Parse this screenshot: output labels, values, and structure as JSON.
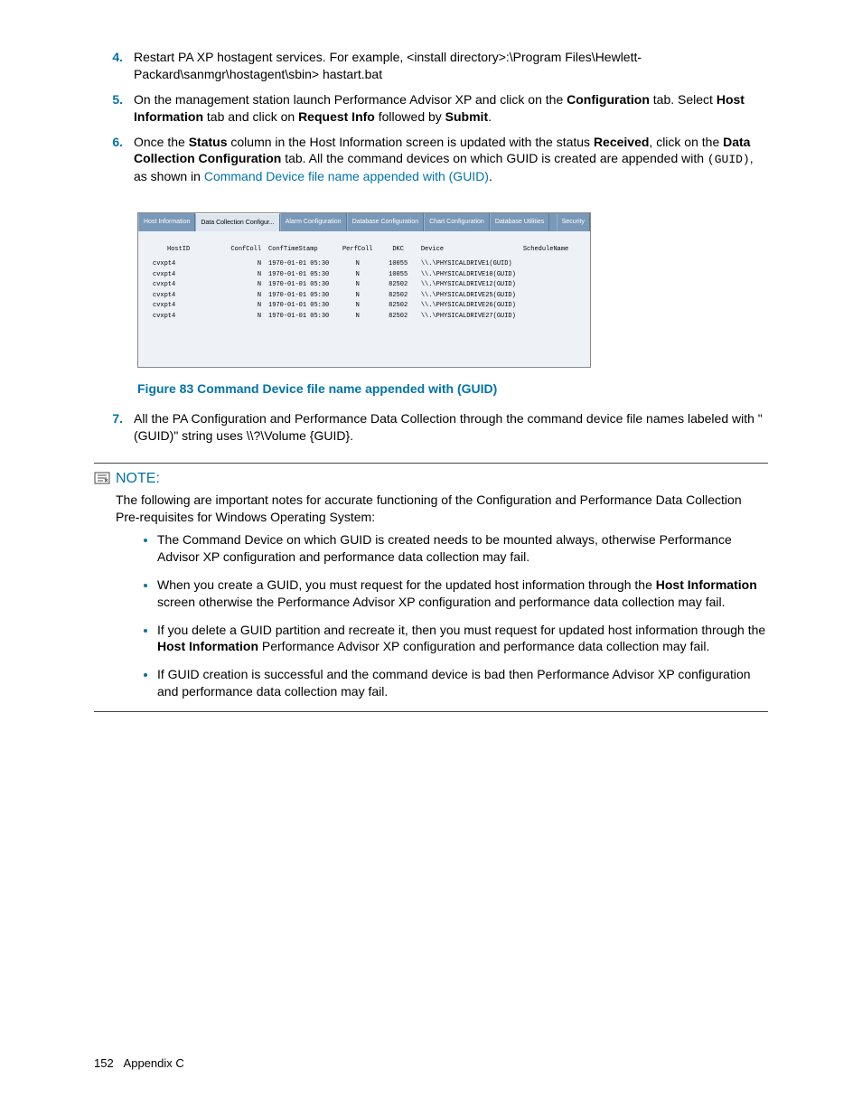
{
  "items": {
    "i4": {
      "num": "4.",
      "a": "Restart PA XP hostagent services.  For example, <install directory>:\\Program Files\\Hewlett-Packard\\sanmgr\\hostagent\\sbin> hastart.bat"
    },
    "i5": {
      "num": "5.",
      "a": "On the management station launch Performance Advisor XP and click on the ",
      "b": "Configuration",
      "c": " tab. Select ",
      "d": "Host Information",
      "e": " tab and click on ",
      "f": "Request Info",
      "g": " followed by ",
      "h": "Submit",
      "i": "."
    },
    "i6": {
      "num": "6.",
      "a": "Once the ",
      "b": "Status",
      "c": " column in the Host Information screen is updated with the status ",
      "d": "Received",
      "e": ", click on the ",
      "f": "Data Collection Configuration",
      "g": " tab.  All the command devices on which GUID is created are appended with ",
      "h": "(GUID)",
      "i": ", as shown in ",
      "j": "Command Device file name appended with (GUID)",
      "k": "."
    },
    "i7": {
      "num": "7.",
      "a": "All the PA Configuration and Performance Data Collection through the command device file names labeled with \"(GUID)\" string uses \\\\?\\Volume {GUID}."
    }
  },
  "figure": {
    "caption": "Figure 83 Command Device file name appended with (GUID)",
    "tabs": [
      "Host Information",
      "Data Collection Configur...",
      "Alarm Configuration",
      "Database Configuration",
      "Chart Configuration",
      "Database Utilities",
      "Security"
    ],
    "headers": {
      "h1": "HostID",
      "h2": "ConfColl",
      "h3": "ConfTimeStamp",
      "h4": "PerfColl",
      "h5": "DKC",
      "h6": "Device",
      "h7": "ScheduleName"
    },
    "rows": [
      {
        "host": "cvxpt4",
        "conf": "N",
        "ts": "1970-01-01 05:30",
        "perf": "N",
        "dkc": "10055",
        "dev": "\\\\.\\PHYSICALDRIVE1(GUID)"
      },
      {
        "host": "cvxpt4",
        "conf": "N",
        "ts": "1970-01-01 05:30",
        "perf": "N",
        "dkc": "10055",
        "dev": "\\\\.\\PHYSICALDRIVE10(GUID)"
      },
      {
        "host": "cvxpt4",
        "conf": "N",
        "ts": "1970-01-01 05:30",
        "perf": "N",
        "dkc": "82502",
        "dev": "\\\\.\\PHYSICALDRIVE12(GUID)"
      },
      {
        "host": "cvxpt4",
        "conf": "N",
        "ts": "1970-01-01 05:30",
        "perf": "N",
        "dkc": "82502",
        "dev": "\\\\.\\PHYSICALDRIVE25(GUID)"
      },
      {
        "host": "cvxpt4",
        "conf": "N",
        "ts": "1970-01-01 05:30",
        "perf": "N",
        "dkc": "82502",
        "dev": "\\\\.\\PHYSICALDRIVE26(GUID)"
      },
      {
        "host": "cvxpt4",
        "conf": "N",
        "ts": "1970-01-01 05:30",
        "perf": "N",
        "dkc": "82502",
        "dev": "\\\\.\\PHYSICALDRIVE27(GUID)"
      }
    ]
  },
  "note": {
    "label": "NOTE:",
    "intro": "The following are important notes for accurate functioning of the Configuration and Performance Data Collection Pre-requisites for Windows Operating System:",
    "b1": "The Command Device on which GUID is created needs to be mounted always, otherwise Performance Advisor XP configuration and performance data collection may fail.",
    "b2a": "When you create a GUID, you must request for the updated host information through the ",
    "b2b": "Host Information",
    "b2c": " screen otherwise the Performance Advisor XP configuration and performance data collection may fail.",
    "b3a": "If you delete a GUID partition and recreate it, then you must request for updated host information through the ",
    "b3b": "Host Information",
    "b3c": " Performance Advisor XP configuration and performance data collection may fail.",
    "b4": "If GUID creation is successful and the command device is bad then Performance Advisor XP configuration and performance data collection may fail."
  },
  "footer": {
    "page": "152",
    "section": "Appendix C"
  }
}
